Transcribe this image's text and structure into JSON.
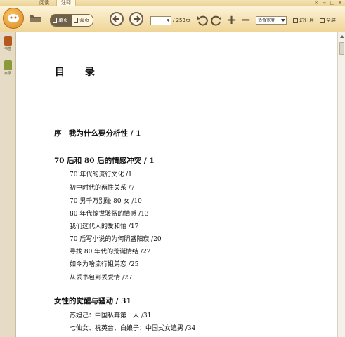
{
  "tabs": [
    {
      "label": "阅读"
    },
    {
      "label": "注释"
    }
  ],
  "toolbar": {
    "single_page": "单页",
    "double_page": "双页",
    "current_page": "9",
    "total_pages": "/ 253页",
    "zoom_mode": "适合宽度",
    "slideshow": "幻灯片",
    "fullscreen": "全屏"
  },
  "sidebar": {
    "items": [
      {
        "label": "书签"
      },
      {
        "label": "目录"
      }
    ]
  },
  "document": {
    "title": "目 录",
    "sections": [
      {
        "heading": "序　我为什么要分析性 / 1",
        "entries": []
      },
      {
        "heading": "70 后和 80 后的情感冲突 / 1",
        "entries": [
          "70 年代的流行文化 /1",
          "初中时代的两性关系 /7",
          "70 男千万别碰 80 女 /10",
          "80 年代惊世骇俗的情感 /13",
          "我们这代人的爱和怕 /17",
          "70 后写小说的为何阴盛阳衰 /20",
          "寻找 80 年代的荒诞情结 /22",
          "如今为啥流行姐弟恋 /25",
          "从丢书包到丢爱情 /27"
        ]
      },
      {
        "heading": "女性的觉醒与骚动 / 31",
        "entries": [
          "苏妲己：中国私奔第一人 /31",
          "七仙女、祝英台、白娘子：中国式女追男 /34"
        ]
      }
    ]
  }
}
